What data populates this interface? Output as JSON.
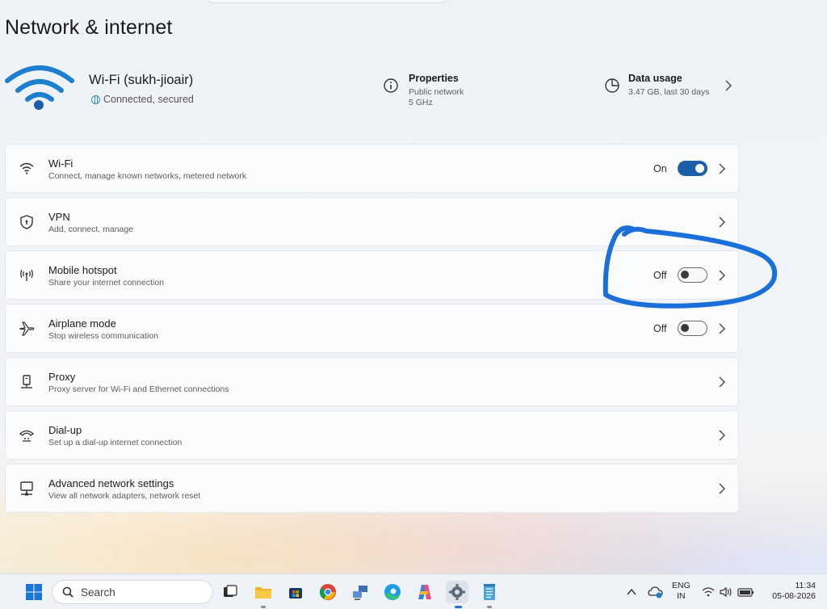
{
  "page": {
    "title": "Network & internet"
  },
  "header": {
    "network_name": "Wi-Fi (sukh-jioair)",
    "network_status": "Connected, secured",
    "properties": {
      "title": "Properties",
      "line1": "Public network",
      "line2": "5 GHz"
    },
    "data_usage": {
      "title": "Data usage",
      "detail": "3.47 GB, last 30 days"
    }
  },
  "settings": [
    {
      "title": "Wi-Fi",
      "subtitle": "Connect, manage known networks, metered network",
      "state": "On",
      "icon": "wifi-icon"
    },
    {
      "title": "VPN",
      "subtitle": "Add, connect, manage",
      "icon": "vpn-shield-icon"
    },
    {
      "title": "Mobile hotspot",
      "subtitle": "Share your internet connection",
      "state": "Off",
      "icon": "hotspot-icon"
    },
    {
      "title": "Airplane mode",
      "subtitle": "Stop wireless communication",
      "state": "Off",
      "icon": "airplane-icon"
    },
    {
      "title": "Proxy",
      "subtitle": "Proxy server for Wi-Fi and Ethernet connections",
      "icon": "proxy-icon"
    },
    {
      "title": "Dial-up",
      "subtitle": "Set up a dial-up internet connection",
      "icon": "dialup-icon"
    },
    {
      "title": "Advanced network settings",
      "subtitle": "View all network adapters, network reset",
      "icon": "advanced-network-icon"
    }
  ],
  "taskbar": {
    "search_placeholder": "Search",
    "language_line1": "ENG",
    "language_line2": "IN",
    "time": "11:34",
    "date": "05-08-2026"
  },
  "colors": {
    "accent": "#1c5fa8",
    "wifi_icon": "#1e7fd0",
    "annotation": "#1a6fd8"
  }
}
